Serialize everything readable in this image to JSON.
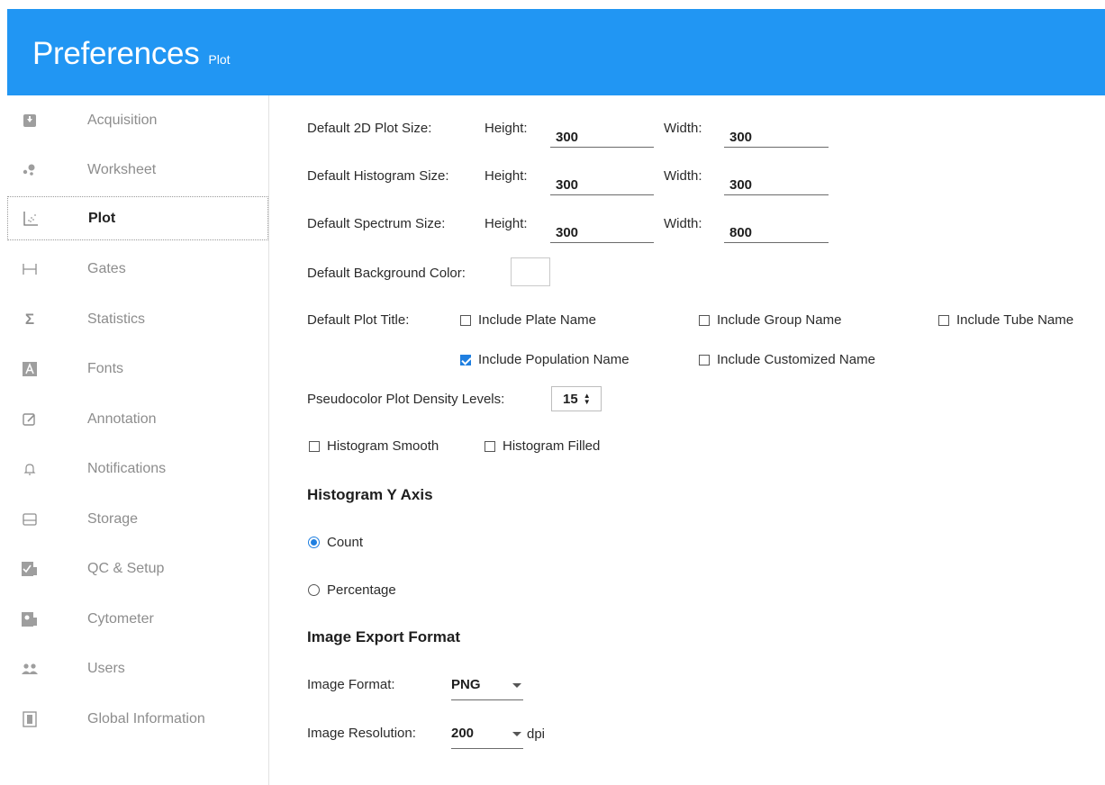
{
  "header": {
    "title": "Preferences",
    "subtitle": "Plot"
  },
  "sidebar": {
    "items": [
      {
        "label": "Acquisition",
        "icon": "acquisition-icon"
      },
      {
        "label": "Worksheet",
        "icon": "worksheet-icon"
      },
      {
        "label": "Plot",
        "icon": "plot-icon",
        "active": true
      },
      {
        "label": "Gates",
        "icon": "gates-icon"
      },
      {
        "label": "Statistics",
        "icon": "sigma-icon"
      },
      {
        "label": "Fonts",
        "icon": "font-icon"
      },
      {
        "label": "Annotation",
        "icon": "annotation-icon"
      },
      {
        "label": "Notifications",
        "icon": "bell-icon"
      },
      {
        "label": "Storage",
        "icon": "storage-icon"
      },
      {
        "label": "QC & Setup",
        "icon": "qc-setup-icon"
      },
      {
        "label": "Cytometer",
        "icon": "cytometer-icon"
      },
      {
        "label": "Users",
        "icon": "users-icon"
      },
      {
        "label": "Global Information",
        "icon": "global-information-icon"
      }
    ]
  },
  "sizes": {
    "height_label": "Height:",
    "width_label": "Width:",
    "plot2d": {
      "label": "Default 2D Plot Size:",
      "height": "300",
      "width": "300"
    },
    "histogram": {
      "label": "Default Histogram Size:",
      "height": "300",
      "width": "300"
    },
    "spectrum": {
      "label": "Default Spectrum Size:",
      "height": "300",
      "width": "800"
    }
  },
  "background": {
    "label": "Default Background Color:",
    "color": "#ffffff"
  },
  "plot_title": {
    "label": "Default Plot Title:",
    "plate": {
      "label": "Include Plate Name",
      "checked": false
    },
    "group": {
      "label": "Include Group Name",
      "checked": false
    },
    "tube": {
      "label": "Include Tube Name",
      "checked": false
    },
    "population": {
      "label": "Include Population Name",
      "checked": true
    },
    "customized": {
      "label": "Include Customized Name",
      "checked": false
    }
  },
  "density": {
    "label": "Pseudocolor Plot Density Levels:",
    "value": "15"
  },
  "histogram_opts": {
    "smooth": {
      "label": "Histogram Smooth",
      "checked": false
    },
    "filled": {
      "label": "Histogram Filled",
      "checked": false
    }
  },
  "y_axis": {
    "title": "Histogram Y Axis",
    "count": {
      "label": "Count",
      "selected": true
    },
    "percentage": {
      "label": "Percentage",
      "selected": false
    }
  },
  "export": {
    "title": "Image Export Format",
    "format_label": "Image Format:",
    "format_value": "PNG",
    "resolution_label": "Image Resolution:",
    "resolution_value": "200",
    "resolution_unit": "dpi"
  },
  "colors": {
    "header": "#2196f3",
    "accent": "#1f7fe0"
  }
}
